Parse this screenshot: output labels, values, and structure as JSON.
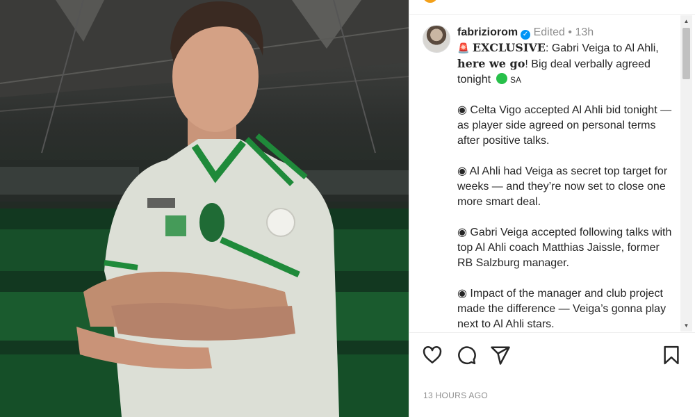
{
  "post": {
    "username": "fabriziorom",
    "edited": "Edited",
    "separator": "•",
    "time_ago": "13h",
    "verified_mark": "✓",
    "caption": {
      "siren": "🚨",
      "exclusive": "EXCLUSIVE",
      "line1_rest": ": Gabri Veiga to Al Ahli,",
      "here_we_go": "here we go",
      "line2_rest": "! Big deal verbally agreed tonight",
      "flag_label": "SA",
      "bullets": [
        "◉ Celta Vigo accepted Al Ahli bid tonight — as player side agreed on personal terms after positive talks.",
        "◉ Al Ahli had Veiga as secret top target for weeks — and they’re now set to close one more smart deal.",
        "◉ Gabri Veiga accepted following talks with top Al Ahli coach Matthias Jaissle, former RB Salzburg manager.",
        "◉ Impact of the manager and club project made the difference — Veiga’s gonna play next to Al Ahli stars."
      ]
    },
    "timestamp": "13 HOURS AGO"
  },
  "icons": {
    "like": "heart-icon",
    "comment": "comment-icon",
    "share": "share-icon",
    "save": "bookmark-icon",
    "scroll_up": "▲",
    "scroll_down": "▼"
  },
  "colors": {
    "verified": "#0095f6",
    "flag_green": "#27c04a",
    "jersey_green": "#1f8a3a",
    "meta_gray": "#8e8e8e"
  }
}
